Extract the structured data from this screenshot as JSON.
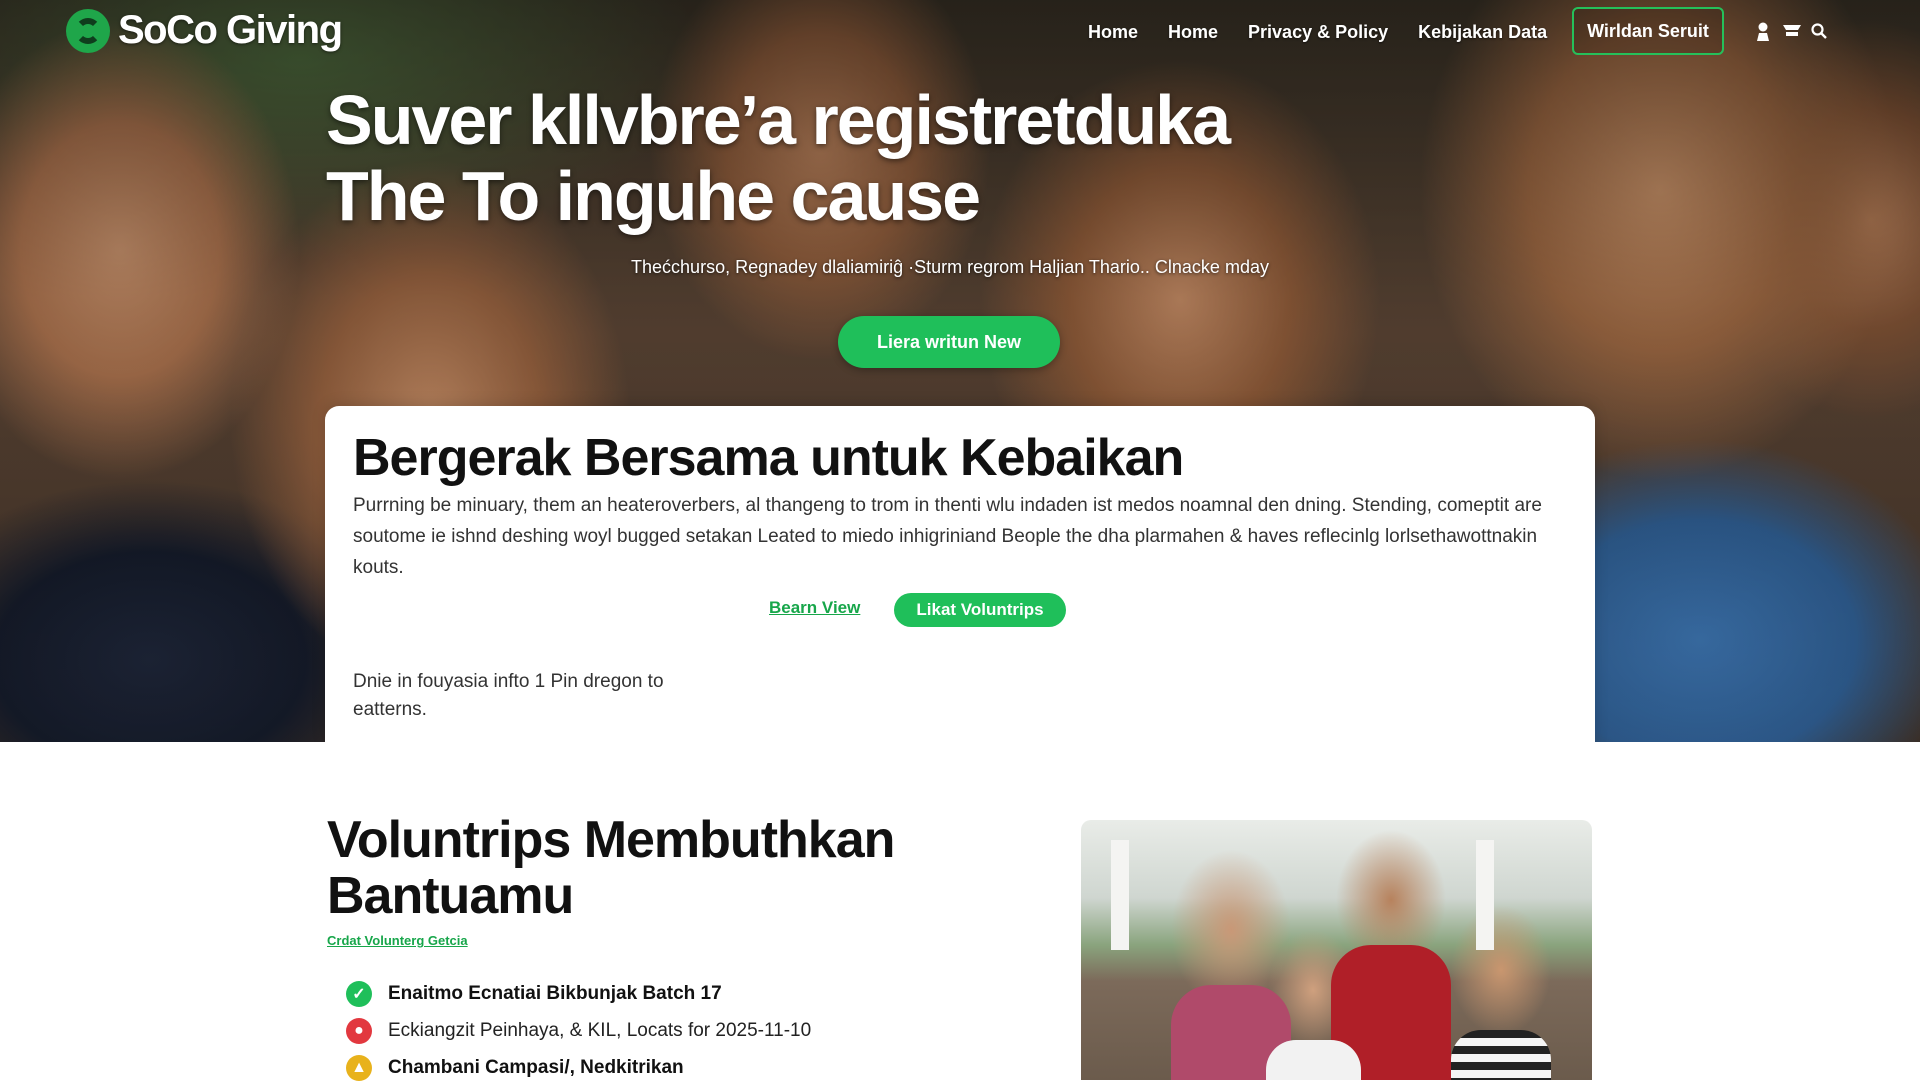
{
  "brand": {
    "name": "SoCo Giving",
    "accent": "#1fbf5a"
  },
  "nav": {
    "links": [
      "Home",
      "Home",
      "Privacy & Policy",
      "Kebijakan Data"
    ],
    "cta": "Wirldan Seruit",
    "icons": [
      "user-icon",
      "cart-icon",
      "search-icon"
    ]
  },
  "hero": {
    "title_line1": "Suver kllvbre’a registretduka",
    "title_line2": "The To inguhe cause",
    "subtitle": "Thećchurso, Regnadey dlaliamiriĝ ·Sturm regrom Haljian Thario.. Clnacke mday",
    "button": "Liera writun New"
  },
  "card": {
    "title": "Bergerak Bersama untuk Kebaikan",
    "body": "Purrning be minuary, them an heateroverbers, al thangeng to trom in thenti wlu indaden ist medos noamnal den dning. Stending, comeptit are soutome ie ishnd deshing woyl bugged setakan Leated to miedo inhigriniand Beople the dha plarmahen & haves reflecinlg lorlsethawottnakin kouts.",
    "link_label": "Bearn View",
    "pill_label": "Likat Voluntrips",
    "note": "Dnie in fouyasia infto 1 Pin dregon to eatterns."
  },
  "section": {
    "title": "Voluntrips Membuthkan Bantuamu",
    "tag": "Crdat Volunterg Getcia",
    "items": [
      {
        "text": "Enaitmo Ecnatiai Bikbunjak Batch 17",
        "icon": "check-icon",
        "color": "#1fbf5a"
      },
      {
        "text": "Eckiangzit Peinhaya, & KIL, Locats for 2025-11-10",
        "icon": "alert-icon",
        "color": "#e2383f"
      },
      {
        "text": "Chambani Campasi/, Nedkitrikan",
        "icon": "lock-icon",
        "color": "#e8b21c"
      }
    ]
  }
}
